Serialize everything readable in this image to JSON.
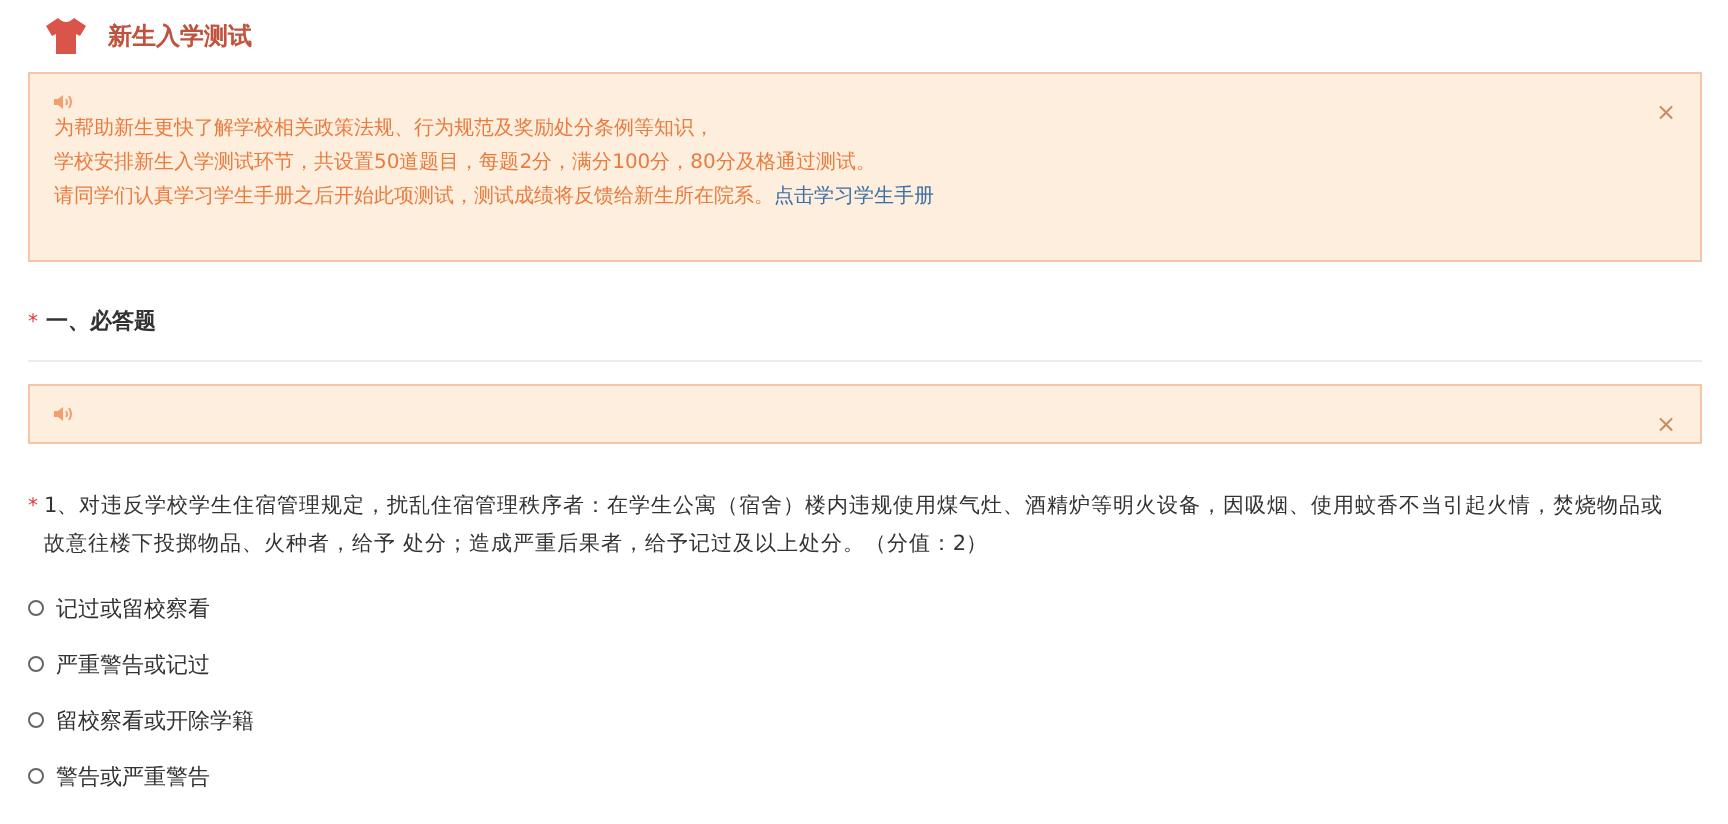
{
  "header": {
    "title": "新生入学测试"
  },
  "notice": {
    "lines": [
      "为帮助新生更快了解学校相关政策法规、行为规范及奖励处分条例等知识，",
      "学校安排新生入学测试环节，共设置50道题目，每题2分，满分100分，80分及格通过测试。",
      "请同学们认真学习学生手册之后开始此项测试，测试成绩将反馈给新生所在院系。"
    ],
    "link": "点击学习学生手册",
    "close": "×"
  },
  "section": {
    "required_mark": "*",
    "title": "一、必答题"
  },
  "section_notice": {
    "close": "×"
  },
  "question": {
    "required_mark": "*",
    "text": "1、对违反学校学生住宿管理规定，扰乱住宿管理秩序者：在学生公寓（宿舍）楼内违规使用煤气灶、酒精炉等明火设备，因吸烟、使用蚊香不当引起火情，焚烧物品或故意往楼下投掷物品、火种者，给予 处分；造成严重后果者，给予记过及以上处分。（分值：2）",
    "options": [
      {
        "label": "记过或留校察看",
        "selected": false
      },
      {
        "label": "严重警告或记过",
        "selected": false
      },
      {
        "label": "留校察看或开除学籍",
        "selected": false
      },
      {
        "label": "警告或严重警告",
        "selected": false
      }
    ]
  }
}
